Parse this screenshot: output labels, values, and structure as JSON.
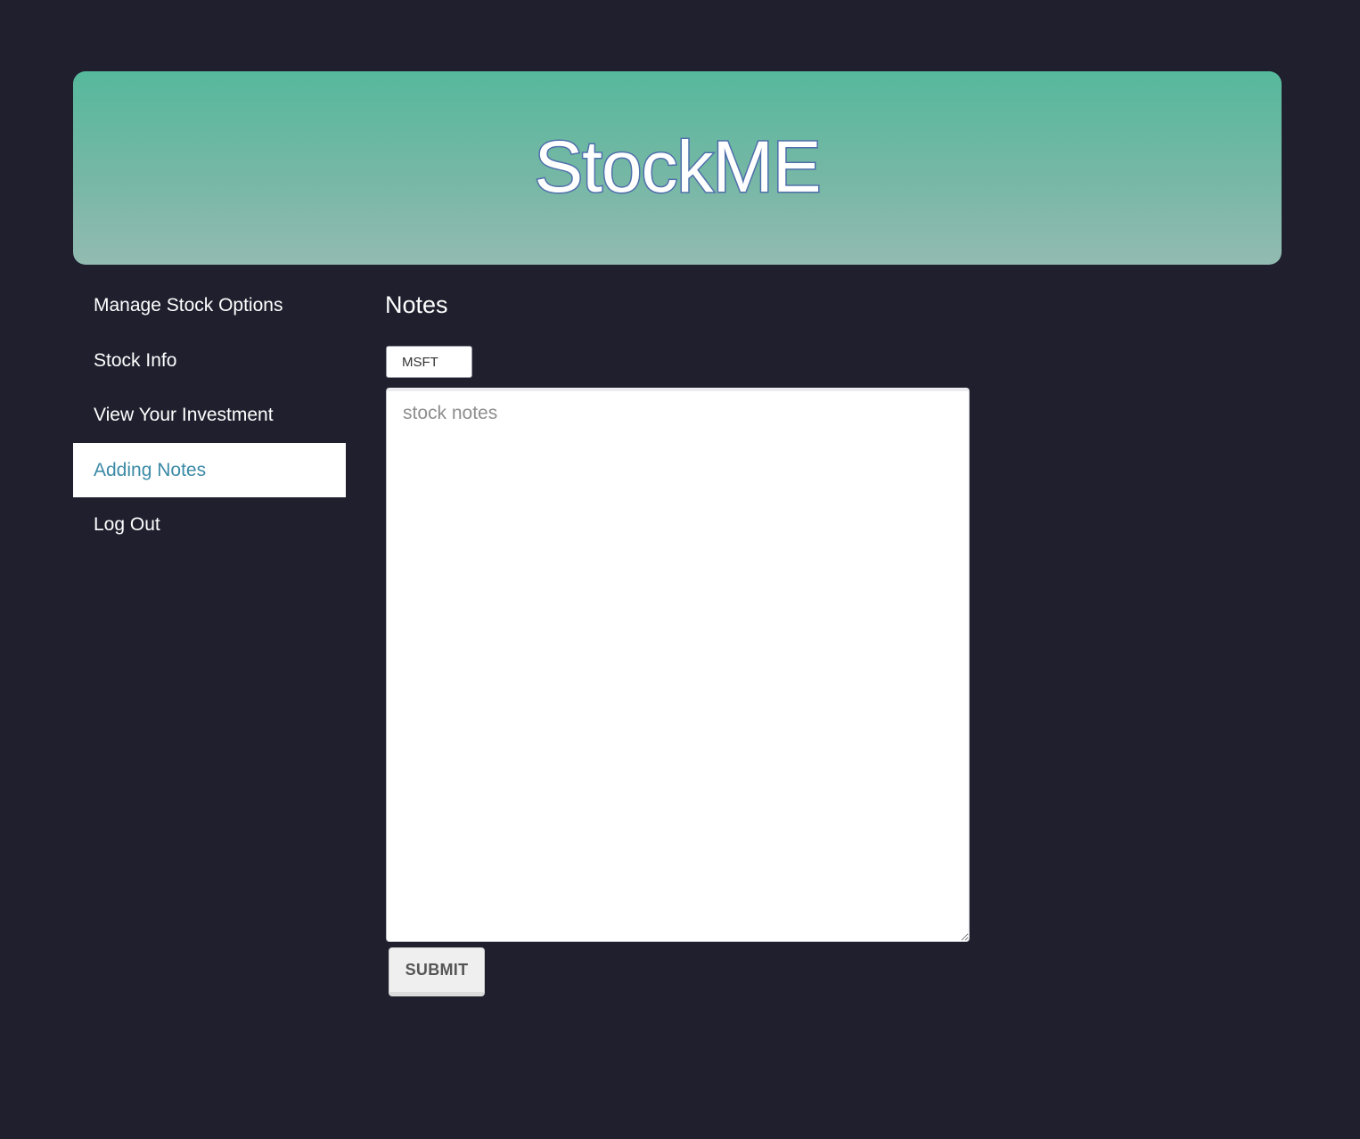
{
  "header": {
    "brand": "StockME"
  },
  "sidebar": {
    "items": [
      {
        "label": "Manage Stock Options"
      },
      {
        "label": "Stock Info"
      },
      {
        "label": "View Your Investment"
      },
      {
        "label": "Adding Notes",
        "active": true
      },
      {
        "label": "Log Out"
      }
    ]
  },
  "main": {
    "title": "Notes",
    "ticker_value": "MSFT",
    "notes_placeholder": "stock notes",
    "notes_value": "",
    "submit_label": "SUBMIT"
  },
  "colors": {
    "background": "#1f1f2e",
    "banner_top": "#56b99c",
    "banner_bottom": "#93bbb1",
    "brand_outline": "#4e6fab",
    "active_nav_text": "#3b8aa6"
  }
}
